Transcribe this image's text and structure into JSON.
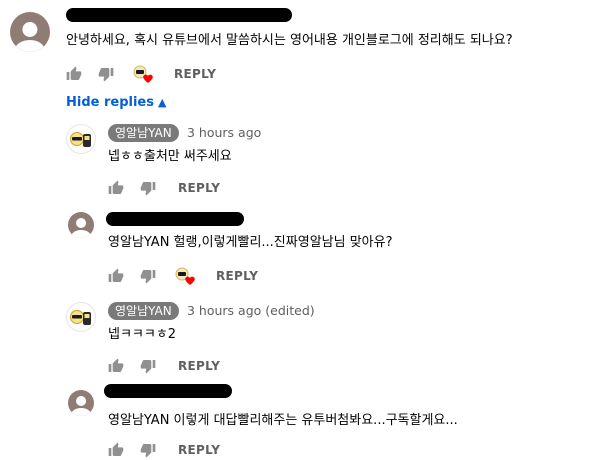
{
  "comments": [
    {
      "type": "top",
      "text": "안녕하세요, 혹시 유튜브에서 말씀하시는 영어내용 개인블로그에 정리해도 되나요?",
      "reply_label": "REPLY"
    },
    {
      "type": "reply",
      "author": "영알남YAN",
      "time": "3 hours ago",
      "text": "넵ㅎㅎ출처만 써주세요",
      "reply_label": "REPLY"
    },
    {
      "type": "reply",
      "text": "영알남YAN 헐랭,이렇게빨리...진짜영알남님 맞아유?",
      "reply_label": "REPLY"
    },
    {
      "type": "reply",
      "author": "영알남YAN",
      "time": "3 hours ago (edited)",
      "text": "넵ㅋㅋㅋㅎ2",
      "reply_label": "REPLY"
    },
    {
      "type": "reply",
      "text": "영알남YAN 이렇게 대답빨리해주는 유투버첨봐요...구독할게요...",
      "reply_label": "REPLY"
    }
  ],
  "hide_replies_label": "Hide replies",
  "colors": {
    "link_blue": "#065fd4",
    "meta_gray": "#606060",
    "badge_gray": "#7a7a7a",
    "heart_red": "#ff0000",
    "avatar_brown": "#8f7c75"
  },
  "icons": [
    "thumb-up-icon",
    "thumb-down-icon",
    "creator-heart-icon",
    "chevron-up-icon"
  ]
}
